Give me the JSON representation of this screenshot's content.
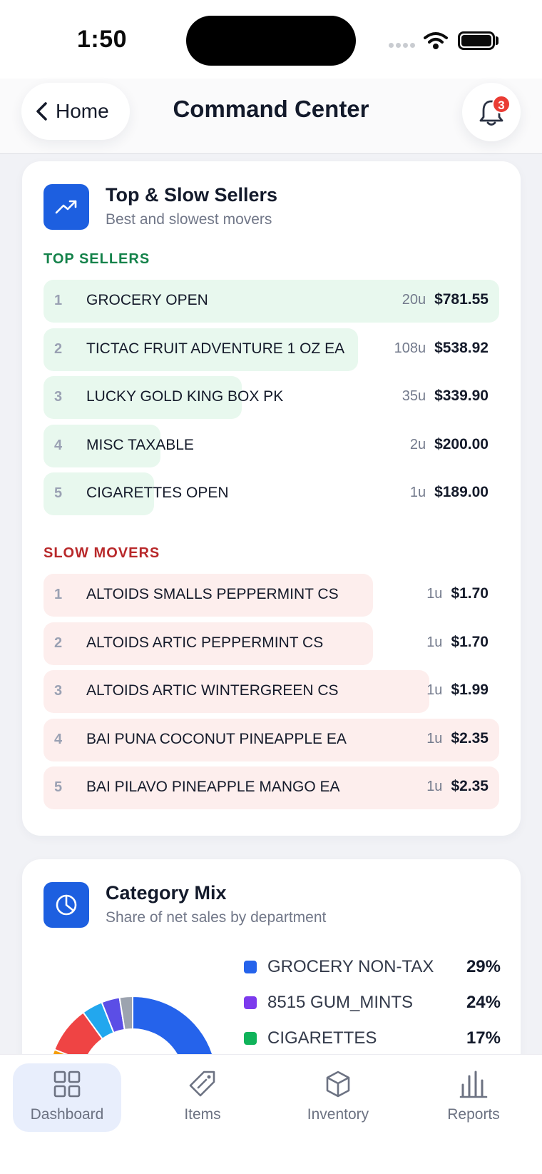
{
  "status_bar": {
    "time": "1:50"
  },
  "header": {
    "back_label": "Home",
    "title": "Command Center",
    "notification_count": "3"
  },
  "sellers_card": {
    "title": "Top & Slow Sellers",
    "subtitle": "Best and slowest movers",
    "top_label": "TOP SELLERS",
    "slow_label": "SLOW MOVERS",
    "top_sellers": [
      {
        "rank": "1",
        "name": "GROCERY OPEN",
        "units": "20u",
        "amount": "$781.55",
        "share": 1.0
      },
      {
        "rank": "2",
        "name": "TICTAC FRUIT ADVENTURE 1 OZ EA",
        "units": "108u",
        "amount": "$538.92",
        "share": 0.69
      },
      {
        "rank": "3",
        "name": "LUCKY GOLD KING BOX PK",
        "units": "35u",
        "amount": "$339.90",
        "share": 0.435
      },
      {
        "rank": "4",
        "name": "MISC TAXABLE",
        "units": "2u",
        "amount": "$200.00",
        "share": 0.256
      },
      {
        "rank": "5",
        "name": "CIGARETTES OPEN",
        "units": "1u",
        "amount": "$189.00",
        "share": 0.242
      }
    ],
    "slow_movers": [
      {
        "rank": "1",
        "name": "ALTOIDS SMALLS PEPPERMINT CS",
        "units": "1u",
        "amount": "$1.70",
        "share": 0.723
      },
      {
        "rank": "2",
        "name": "ALTOIDS ARTIC PEPPERMINT CS",
        "units": "1u",
        "amount": "$1.70",
        "share": 0.723
      },
      {
        "rank": "3",
        "name": "ALTOIDS ARTIC WINTERGREEN CS",
        "units": "1u",
        "amount": "$1.99",
        "share": 0.847
      },
      {
        "rank": "4",
        "name": "BAI PUNA COCONUT PINEAPPLE EA",
        "units": "1u",
        "amount": "$2.35",
        "share": 1.0
      },
      {
        "rank": "5",
        "name": "BAI PILAVO PINEAPPLE MANGO EA",
        "units": "1u",
        "amount": "$2.35",
        "share": 1.0
      }
    ]
  },
  "category_card": {
    "title": "Category Mix",
    "subtitle": "Share of net sales by department",
    "legend": [
      {
        "name": "GROCERY NON-TAX",
        "pct": "29%",
        "color": "#2563eb"
      },
      {
        "name": "8515 GUM_MINTS",
        "pct": "24%",
        "color": "#7c3aed"
      },
      {
        "name": "CIGARETTES",
        "pct": "17%",
        "color": "#10b35a"
      }
    ]
  },
  "chart_data": {
    "type": "pie",
    "title": "Category Mix",
    "subtitle": "Share of net sales by department",
    "slices": [
      {
        "name": "GROCERY NON-TAX",
        "value": 29,
        "color": "#2563eb"
      },
      {
        "name": "8515 GUM_MINTS",
        "value": 24,
        "color": "#7c3aed"
      },
      {
        "name": "CIGARETTES",
        "value": 17,
        "color": "#10b35a"
      },
      {
        "name": "",
        "value": 11,
        "color": "#f59e0b"
      },
      {
        "name": "",
        "value": 9,
        "color": "#ef4444"
      },
      {
        "name": "",
        "value": 4,
        "color": "#22a7ee"
      },
      {
        "name": "",
        "value": 3.5,
        "color": "#5b4ee6"
      },
      {
        "name": "",
        "value": 2.5,
        "color": "#9ca3af"
      }
    ]
  },
  "tabs": [
    {
      "label": "Dashboard",
      "icon": "grid-icon",
      "active": true
    },
    {
      "label": "Items",
      "icon": "tag-icon",
      "active": false
    },
    {
      "label": "Inventory",
      "icon": "box-icon",
      "active": false
    },
    {
      "label": "Reports",
      "icon": "bar-chart-icon",
      "active": false
    }
  ],
  "colors": {
    "accent": "#1d5fe0",
    "top_green": "#14824a",
    "slow_red": "#b8282a",
    "badge_red": "#ea3b33"
  }
}
